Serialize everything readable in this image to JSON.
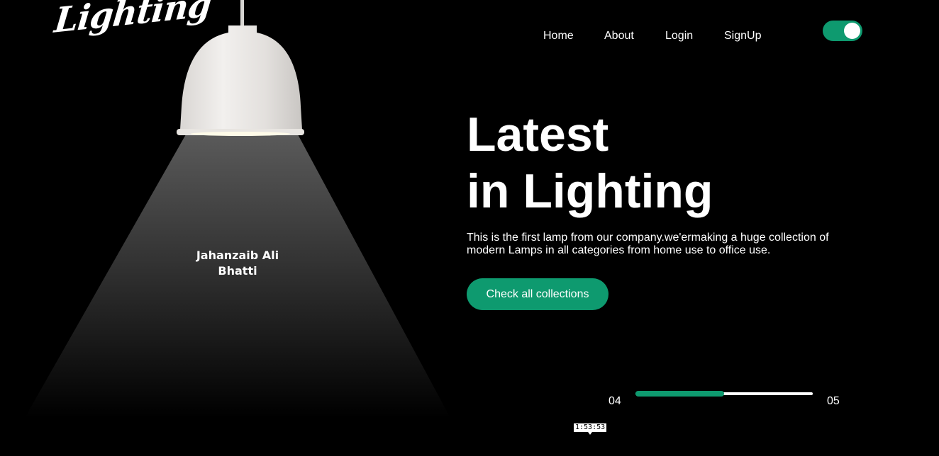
{
  "header": {
    "logo_text": "Lighting",
    "nav": [
      {
        "label": "Home"
      },
      {
        "label": "About"
      },
      {
        "label": "Login"
      },
      {
        "label": "SignUp"
      }
    ],
    "theme_toggle": {
      "state": "on",
      "color": "#0e9a6f"
    }
  },
  "hero": {
    "lamp_caption_line1": "Jahanzaib Ali",
    "lamp_caption_line2": "Bhatti",
    "headline_line1": "Latest",
    "headline_line2": "in Lighting",
    "description": "This is the first lamp from our company.we'ermaking a huge collection of modern Lamps in all categories from home use to office use.",
    "cta_label": "Check all collections"
  },
  "slider": {
    "current": "04",
    "total": "05",
    "progress_fraction": 0.5
  },
  "overlay": {
    "timer": "1:53:53"
  },
  "colors": {
    "accent": "#0e9a6f",
    "background": "#000000",
    "text": "#ffffff"
  }
}
